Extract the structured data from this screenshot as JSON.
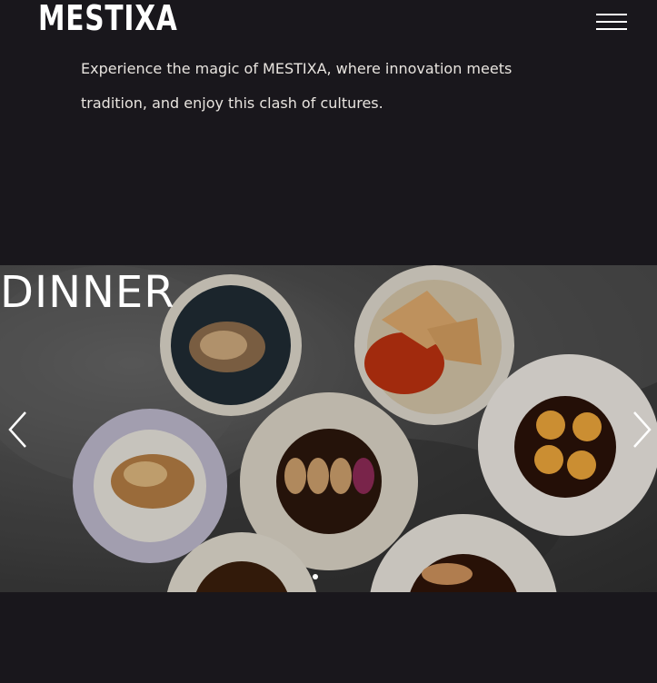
{
  "header": {
    "logo_text": "MESTIXA",
    "menu_icon": "hamburger-menu-icon"
  },
  "intro": {
    "text": "Experience the magic of MESTIXA, where innovation meets tradition, and enjoy this clash of cultures."
  },
  "slider": {
    "title": "DINNER",
    "prev_icon": "chevron-left-icon",
    "next_icon": "chevron-right-icon",
    "dots_count": 1,
    "active_dot": 1
  }
}
